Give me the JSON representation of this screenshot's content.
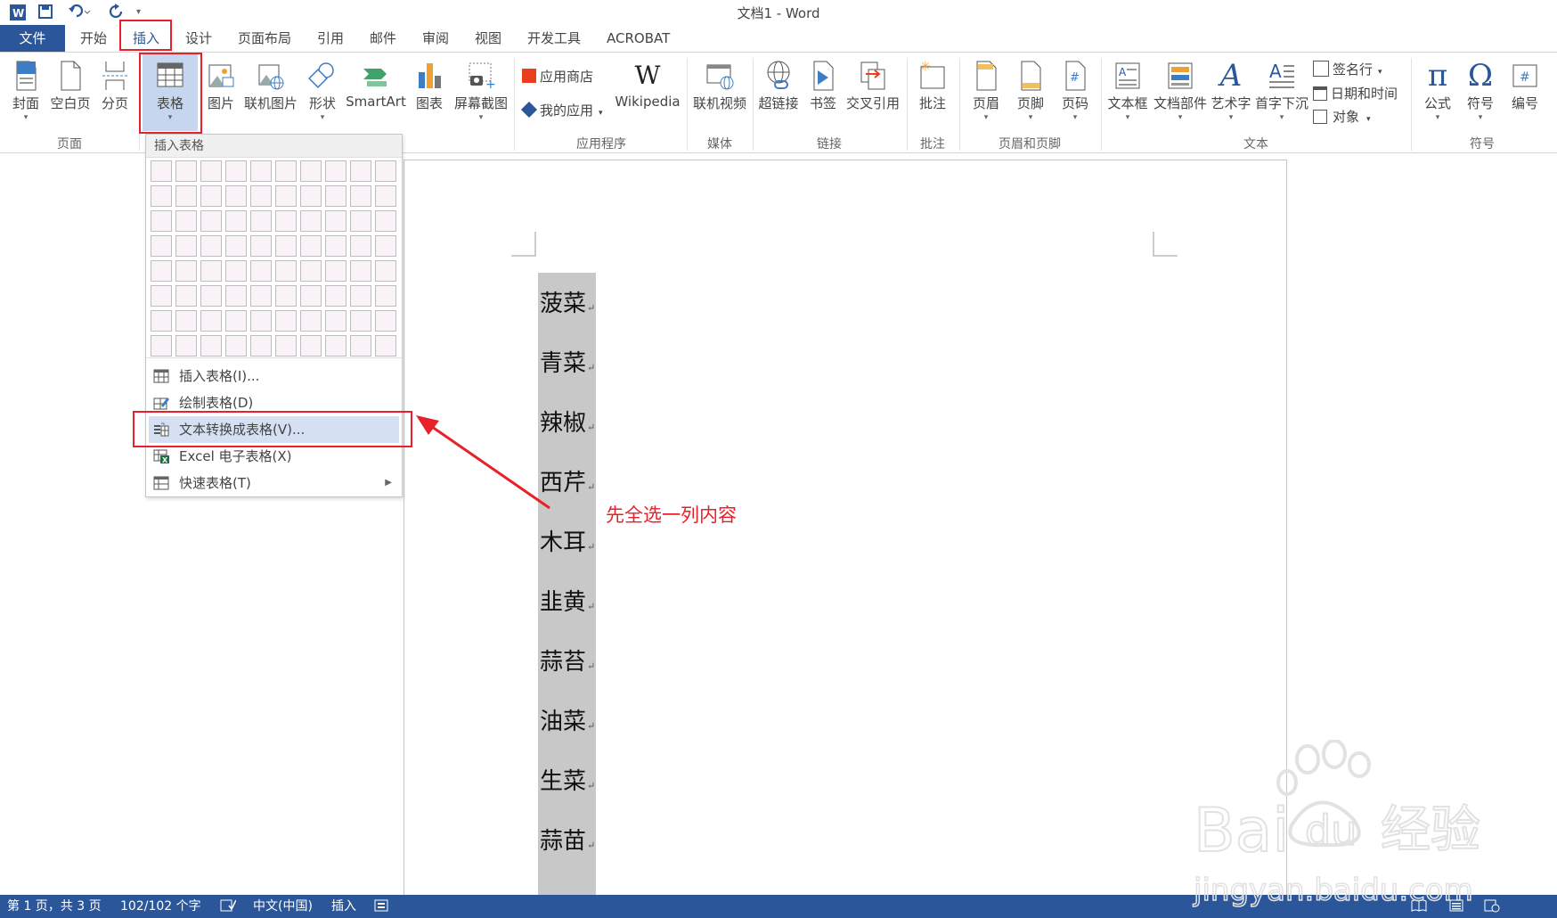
{
  "title_bar": {
    "title": "文档1 - Word"
  },
  "tabs": {
    "file": "文件",
    "items": [
      "开始",
      "插入",
      "设计",
      "页面布局",
      "引用",
      "邮件",
      "审阅",
      "视图",
      "开发工具",
      "ACROBAT"
    ]
  },
  "ribbon": {
    "groups": {
      "pages": "页面",
      "apps": "应用程序",
      "media": "媒体",
      "links": "链接",
      "comments": "批注",
      "header_footer": "页眉和页脚",
      "text": "文本",
      "symbols": "符号"
    },
    "buttons": {
      "cover": "封面",
      "blank": "空白页",
      "break": "分页",
      "table": "表格",
      "picture": "图片",
      "online_picture": "联机图片",
      "shapes": "形状",
      "smartart": "SmartArt",
      "chart": "图表",
      "screenshot": "屏幕截图",
      "store": "应用商店",
      "my_apps": "我的应用",
      "wikipedia": "Wikipedia",
      "online_video": "联机视频",
      "hyperlink": "超链接",
      "bookmark": "书签",
      "cross_ref": "交叉引用",
      "comment": "批注",
      "header": "页眉",
      "footer": "页脚",
      "page_number": "页码",
      "text_box": "文本框",
      "quick_parts": "文档部件",
      "wordart": "艺术字",
      "drop_cap": "首字下沉",
      "signature": "签名行",
      "date_time": "日期和时间",
      "object": "对象",
      "equation": "公式",
      "symbol": "符号",
      "number": "编号"
    }
  },
  "dropdown": {
    "header": "插入表格",
    "items": [
      "插入表格(I)...",
      "绘制表格(D)",
      "文本转换成表格(V)...",
      "Excel 电子表格(X)",
      "快速表格(T)"
    ]
  },
  "document": {
    "lines": [
      "菠菜",
      "青菜",
      "辣椒",
      "西芹",
      "木耳",
      "韭黄",
      "蒜苔",
      "油菜",
      "生菜",
      "蒜苗"
    ],
    "paragraph_mark": "↵"
  },
  "annotation": {
    "text": "先全选一列内容",
    "color": "#e8202a"
  },
  "status_bar": {
    "page": "第 1 页，共 3 页",
    "words": "102/102 个字",
    "language": "中文(中国)",
    "mode": "插入"
  },
  "watermark": {
    "brand": "Bai",
    "brand2": "du",
    "cn": "经验",
    "url": "jingyan.baidu.com"
  },
  "colors": {
    "word_blue": "#2b579a",
    "annotation_red": "#e8202a",
    "selection_gray": "#c8c8c8"
  }
}
